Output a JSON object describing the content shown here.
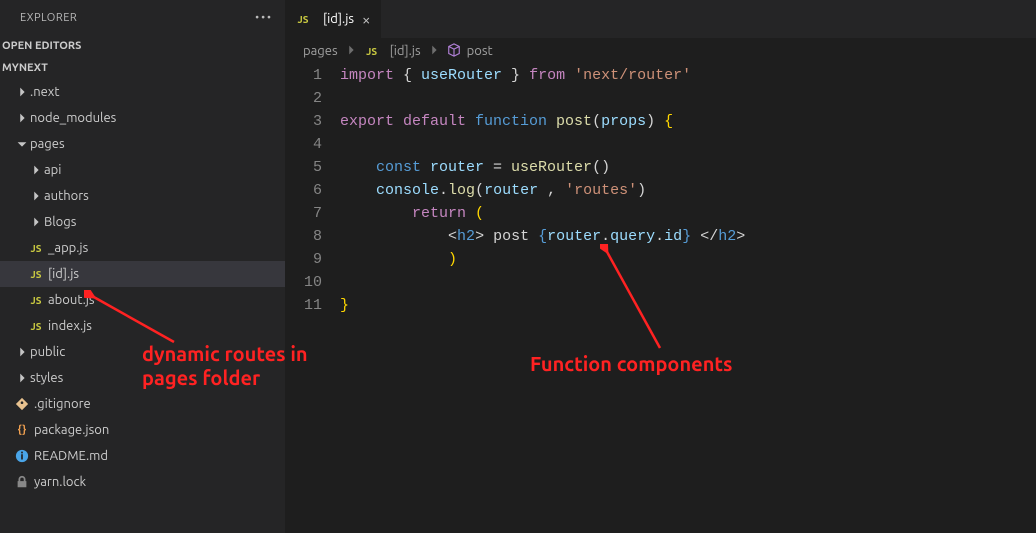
{
  "explorer": {
    "title": "EXPLORER"
  },
  "sections": {
    "openEditors": "OPEN EDITORS",
    "project": "MYNEXT"
  },
  "tree": {
    "next": ".next",
    "node_modules": "node_modules",
    "pages": "pages",
    "api": "api",
    "authors": "authors",
    "blogs": "Blogs",
    "appjs": "_app.js",
    "idjs": "[id].js",
    "aboutjs": "about.js",
    "indexjs": "index.js",
    "public": "public",
    "styles": "styles",
    "gitignore": ".gitignore",
    "packagejson": "package.json",
    "readme": "README.md",
    "yarnlock": "yarn.lock"
  },
  "tab": {
    "file": "[id].js"
  },
  "breadcrumb": {
    "p0": "pages",
    "p1": "[id].js",
    "p2": "post"
  },
  "code": {
    "l1_import": "import",
    "l1_lb": " { ",
    "l1_use": "useRouter",
    "l1_rb": " } ",
    "l1_from": "from",
    "l1_str": " 'next/router'",
    "l3_export": "export",
    "l3_default": " default ",
    "l3_function": "function",
    "l3_name": " post",
    "l3_lp": "(",
    "l3_props": "props",
    "l3_rp": ")",
    "l3_lb": " {",
    "l5_const": "    const ",
    "l5_router": "router",
    "l5_eq": " = ",
    "l5_use": "useRouter",
    "l5_call": "()",
    "l6_console": "    console",
    "l6_dot": ".",
    "l6_log": "log",
    "l6_lp": "(",
    "l6_router": "router",
    "l6_sep": " , ",
    "l6_str": "'routes'",
    "l6_rp": ")",
    "l7_return": "        return ",
    "l7_lp": "(",
    "l8_pad": "            ",
    "l8_o": "<",
    "l8_h2": "h2",
    "l8_c": ">",
    "l8_txt": " post ",
    "l8_lb": "{",
    "l8_router": "router",
    "l8_d1": ".",
    "l8_query": "query",
    "l8_d2": ".",
    "l8_id": "id",
    "l8_rb": "}",
    "l8_sp": " ",
    "l8_co": "</",
    "l8_h2b": "h2",
    "l8_cc": ">",
    "l9_rp": "            )",
    "l11_rb": "}"
  },
  "annotations": {
    "left": "dynamic routes in pages folder",
    "right": "Function components"
  },
  "colors": {
    "red": "#ff2222"
  }
}
